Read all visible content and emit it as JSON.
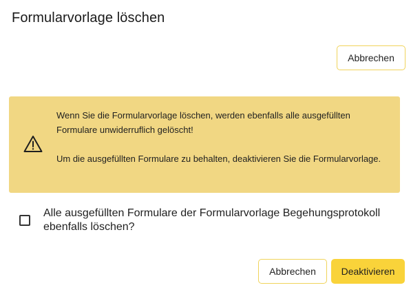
{
  "dialog": {
    "title": "Formularvorlage löschen",
    "top_cancel_label": "Abbrechen",
    "warning": {
      "icon": "warning-triangle-icon",
      "paragraph1": "Wenn Sie die Formularvorlage löschen, werden ebenfalls alle ausgefüllten Formulare unwiderruflich gelöscht!",
      "paragraph2": "Um die ausgefüllten Formulare zu behalten, deaktivieren Sie die Formularvorlage."
    },
    "checkbox": {
      "checked": false,
      "label": "Alle ausgefüllten Formulare der Formularvorlage Begehungsprotokoll ebenfalls löschen?"
    },
    "footer": {
      "cancel_label": "Abbrechen",
      "confirm_label": "Deaktivieren"
    }
  },
  "colors": {
    "accent": "#f9d33a",
    "accent_border": "#f0d35a",
    "warning_background": "#f1d783"
  }
}
